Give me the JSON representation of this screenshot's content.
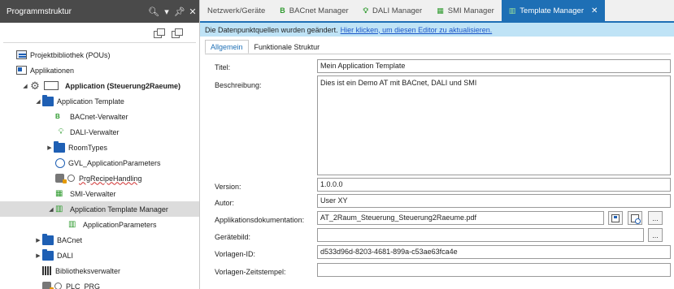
{
  "left_panel": {
    "title": "Programmstruktur",
    "tree": [
      {
        "label": "Projektbibliothek (POUs)"
      },
      {
        "label": "Applikationen"
      },
      {
        "label": "Application (Steuerung2Raeume)"
      },
      {
        "label": "Application Template"
      },
      {
        "label": "BACnet-Verwalter",
        "icon_text": "B"
      },
      {
        "label": "DALI-Verwalter"
      },
      {
        "label": "RoomTypes"
      },
      {
        "label": "GVL_ApplicationParameters"
      },
      {
        "label": "PrgRecipeHandling"
      },
      {
        "label": "SMI-Verwalter"
      },
      {
        "label": "Application Template Manager"
      },
      {
        "label": "ApplicationParameters"
      },
      {
        "label": "BACnet"
      },
      {
        "label": "DALI"
      },
      {
        "label": "Bibliotheksverwalter"
      },
      {
        "label": "PLC_PRG"
      }
    ]
  },
  "tabs": [
    {
      "label": "Netzwerk/Geräte"
    },
    {
      "label": "BACnet Manager",
      "icon_text": "B"
    },
    {
      "label": "DALI Manager"
    },
    {
      "label": "SMI Manager"
    },
    {
      "label": "Template Manager"
    }
  ],
  "notice": {
    "text": "Die Datenpunktquellen wurden geändert.",
    "link": "Hier klicken, um diesen Editor zu aktualisieren."
  },
  "subtabs": [
    {
      "label": "Allgemein"
    },
    {
      "label": "Funktionale Struktur"
    }
  ],
  "form": {
    "titel_label": "Titel:",
    "titel_value": "Mein Application Template",
    "beschreibung_label": "Beschreibung:",
    "beschreibung_value": "Dies ist ein Demo AT mit BACnet, DALI und SMI",
    "version_label": "Version:",
    "version_value": "1.0.0.0",
    "autor_label": "Autor:",
    "autor_value": "User XY",
    "doku_label": "Applikationsdokumentation:",
    "doku_value": "AT_2Raum_Steuerung_Steuerung2Raeume.pdf",
    "geraetebild_label": "Gerätebild:",
    "geraetebild_value": "",
    "vorlagen_id_label": "Vorlagen-ID:",
    "vorlagen_id_value": "d533d96d-8203-4681-899a-c53ae63fca4e",
    "zeitstempel_label": "Vorlagen-Zeitstempel:",
    "zeitstempel_value": "",
    "browse_label": "..."
  },
  "colors": {
    "accent": "#1e6fb5",
    "header_bg": "#4a4a4a",
    "notice_bg": "#bfe3f6",
    "link": "#1a55c8",
    "green_icon": "#2e9a2e",
    "folder_blue": "#1e5fb4"
  }
}
